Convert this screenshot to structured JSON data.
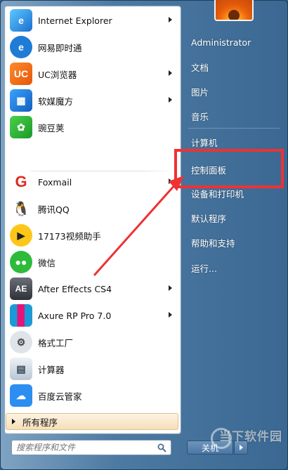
{
  "left_pane": {
    "pinned": [
      {
        "label": "Internet Explorer",
        "icon": "ie-icon",
        "has_submenu": true
      },
      {
        "label": "网易即时通",
        "icon": "netease-popo-icon",
        "has_submenu": false
      },
      {
        "label": "UC浏览器",
        "icon": "uc-browser-icon",
        "has_submenu": true
      },
      {
        "label": "软媒魔方",
        "icon": "ruanmei-mofang-icon",
        "has_submenu": true
      },
      {
        "label": "豌豆荚",
        "icon": "wandoujia-icon",
        "has_submenu": false
      }
    ],
    "recent": [
      {
        "label": "Foxmail",
        "icon": "foxmail-icon",
        "has_submenu": true
      },
      {
        "label": "腾讯QQ",
        "icon": "qq-icon",
        "has_submenu": false
      },
      {
        "label": "17173视频助手",
        "icon": "17173-icon",
        "has_submenu": false
      },
      {
        "label": "微信",
        "icon": "wechat-icon",
        "has_submenu": false
      },
      {
        "label": "After Effects CS4",
        "icon": "after-effects-icon",
        "has_submenu": true
      },
      {
        "label": "Axure RP Pro 7.0",
        "icon": "axure-icon",
        "has_submenu": true
      },
      {
        "label": "格式工厂",
        "icon": "format-factory-icon",
        "has_submenu": false
      },
      {
        "label": "计算器",
        "icon": "calculator-icon",
        "has_submenu": false
      },
      {
        "label": "百度云管家",
        "icon": "baidu-cloud-icon",
        "has_submenu": false
      }
    ],
    "all_programs": "所有程序",
    "search_placeholder": "搜索程序和文件"
  },
  "right_pane": {
    "items": [
      "Administrator",
      "文档",
      "图片",
      "音乐",
      "计算机",
      "控制面板",
      "设备和打印机",
      "默认程序",
      "帮助和支持",
      "运行..."
    ],
    "shutdown_label": "关机"
  },
  "highlighted_item": "控制面板",
  "watermark": "当下软件园",
  "colors": {
    "highlight": "#ee3233",
    "menu_right_bg": "#4d7aa3",
    "all_programs_bg": "#f6dfb9"
  }
}
